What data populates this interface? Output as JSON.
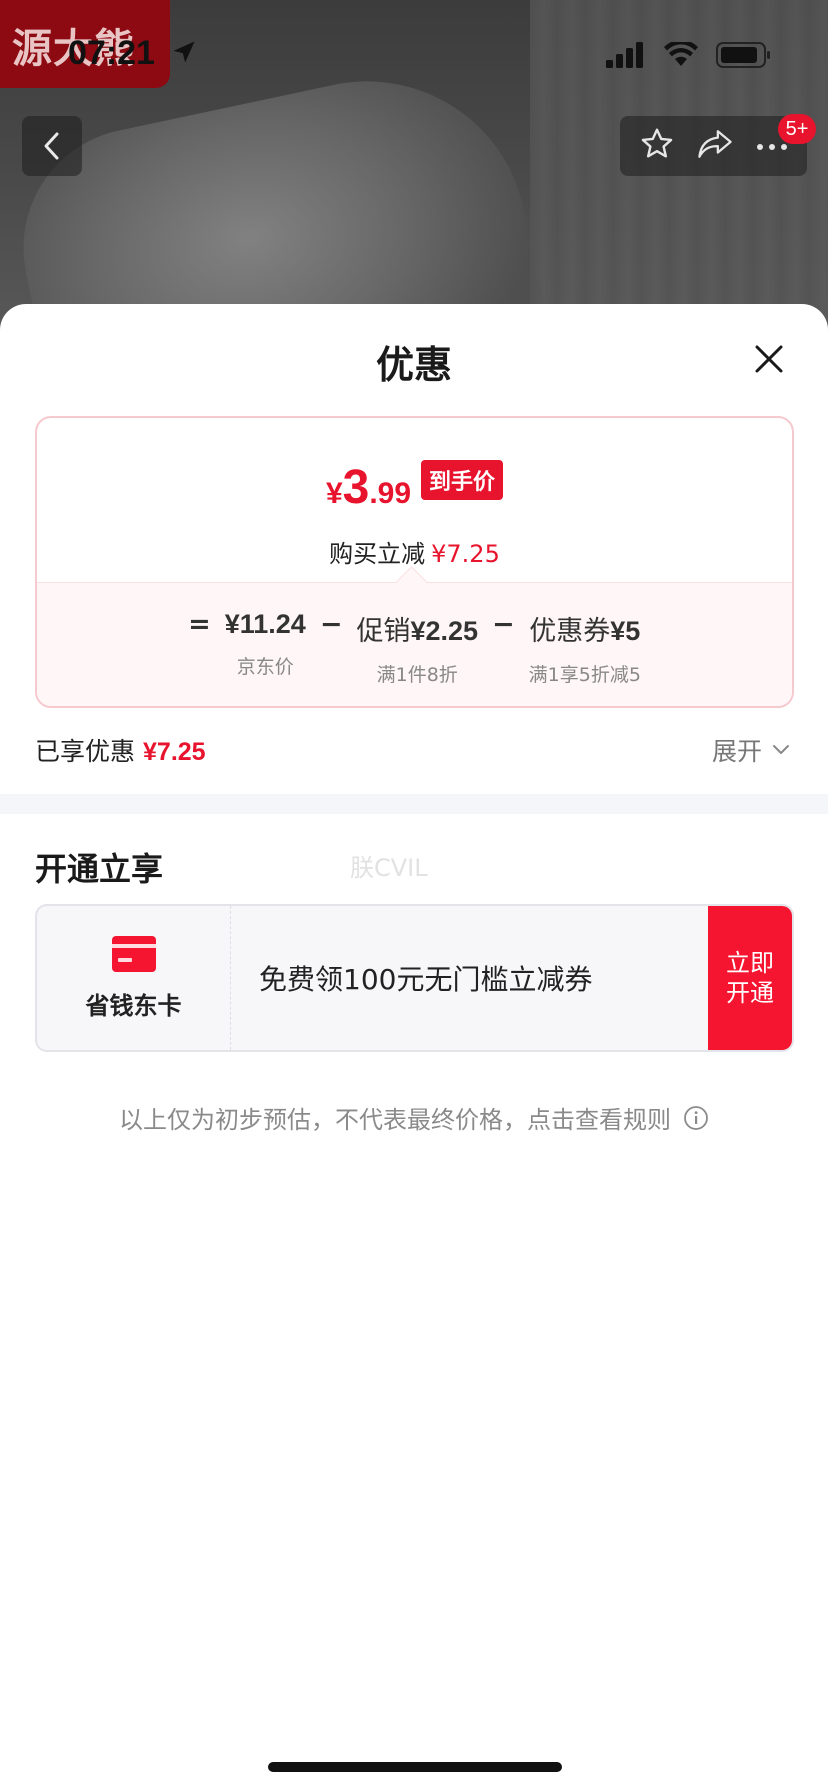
{
  "status_bar": {
    "time": "07:21"
  },
  "watermark": {
    "logo_text": "源大熊",
    "faint_text": "朕CVIL"
  },
  "nav": {
    "badge": "5+"
  },
  "sheet": {
    "title": "优惠",
    "price_card": {
      "currency": "¥",
      "final_int": "3",
      "final_dec": ".99",
      "tag": "到手价",
      "reduce_label": "购买立减",
      "reduce_amount": "¥7.25",
      "formula": {
        "eq": "=",
        "minus": "−",
        "base_value": "¥11.24",
        "base_sub": "京东价",
        "promo_label": "促销",
        "promo_value": "¥2.25",
        "promo_sub": "满1件8折",
        "coupon_label": "优惠券",
        "coupon_value": "¥5",
        "coupon_sub": "满1享5折减5"
      }
    },
    "enjoyed_label": "已享优惠",
    "enjoyed_amount": "¥7.25",
    "expand_label": "展开",
    "section_title": "开通立享",
    "membership": {
      "name": "省钱东卡",
      "offer": "免费领100元无门槛立减券",
      "button_line1": "立即",
      "button_line2": "开通"
    },
    "disclaimer": "以上仅为初步预估，不代表最终价格，点击查看规则"
  },
  "colors": {
    "accent": "#e8132c",
    "button": "#f51530"
  },
  "icons": [
    "location-arrow-icon",
    "signal-icon",
    "wifi-icon",
    "battery-icon",
    "back-icon",
    "star-icon",
    "share-icon",
    "more-icon",
    "close-icon",
    "chevron-down-icon",
    "card-icon",
    "info-icon"
  ]
}
